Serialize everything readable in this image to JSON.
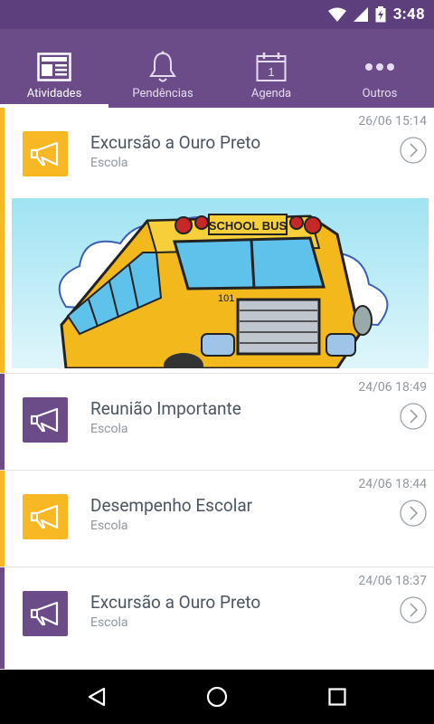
{
  "status_bar": {
    "time": "3:48"
  },
  "tabs": [
    {
      "label": "Atividades",
      "icon": "newspaper-icon",
      "active": true
    },
    {
      "label": "Pendências",
      "icon": "bell-icon",
      "active": false
    },
    {
      "label": "Agenda",
      "icon": "calendar-icon",
      "active": false,
      "calendar_day": "1"
    },
    {
      "label": "Outros",
      "icon": "more-icon",
      "active": false
    }
  ],
  "feed": [
    {
      "title": "Excursão a Ouro Preto",
      "subtitle": "Escola",
      "date": "26/06 15:14",
      "color": "yellow",
      "has_image": true,
      "image_text": "SCHOOL BUS",
      "bus_number": "101"
    },
    {
      "title": "Reunião Importante",
      "subtitle": "Escola",
      "date": "24/06 18:49",
      "color": "purple"
    },
    {
      "title": "Desempenho Escolar",
      "subtitle": "Escola",
      "date": "24/06 18:44",
      "color": "yellow"
    },
    {
      "title": "Excursão a Ouro Preto",
      "subtitle": "Escola",
      "date": "24/06 18:37",
      "color": "purple"
    }
  ],
  "colors": {
    "primary": "#6b4c89",
    "status": "#5e3f7d",
    "accent_yellow": "#f7b824"
  }
}
